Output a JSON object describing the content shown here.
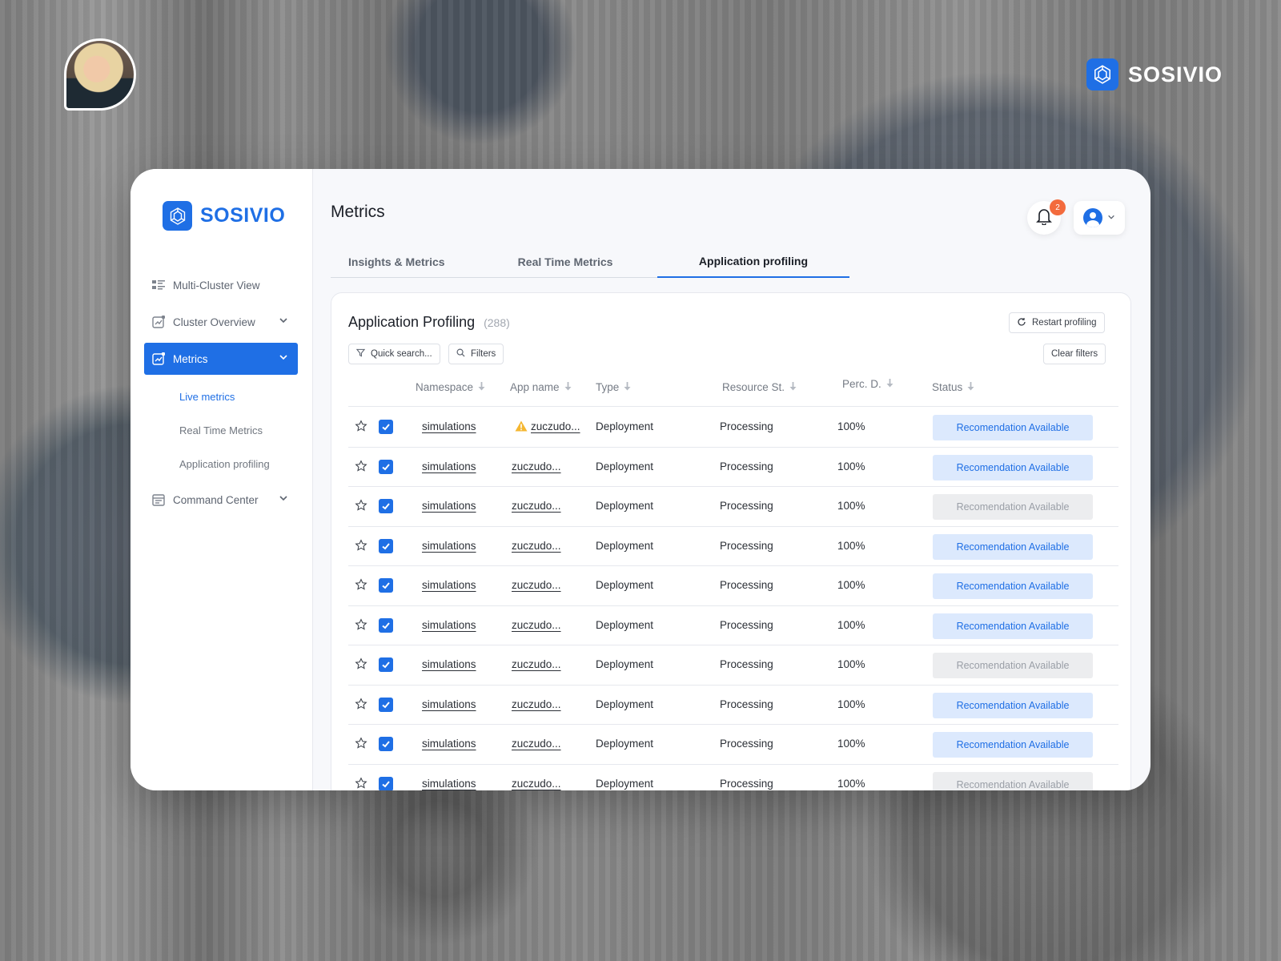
{
  "brand": {
    "name": "SOSIVIO"
  },
  "sidebar": {
    "items": [
      {
        "label": "Multi-Cluster View",
        "icon": "list-icon",
        "expandable": false
      },
      {
        "label": "Cluster Overview",
        "icon": "chart-icon",
        "expandable": true
      },
      {
        "label": "Metrics",
        "icon": "chart-icon",
        "expandable": true,
        "active": true
      },
      {
        "label": "Command Center",
        "icon": "calendar-icon",
        "expandable": true
      }
    ],
    "sub_items": [
      {
        "label": "Live metrics",
        "active": true
      },
      {
        "label": "Real Time Metrics",
        "active": false
      },
      {
        "label": "Application profiling",
        "active": false
      }
    ]
  },
  "header": {
    "title": "Metrics",
    "notifications_count": "2"
  },
  "tabs": [
    {
      "label": "Insights & Metrics",
      "active": false
    },
    {
      "label": "Real Time Metrics",
      "active": false
    },
    {
      "label": "Application profiling",
      "active": true
    }
  ],
  "panel": {
    "title": "Application Profiling",
    "count": "(288)",
    "restart_label": "Restart profiling",
    "quick_search_label": "Quick search...",
    "filters_label": "Filters",
    "clear_filters_label": "Clear filters"
  },
  "table": {
    "columns": [
      "Namespace",
      "App name",
      "Type",
      "Resource St.",
      "Perc. D.",
      "Status"
    ],
    "rows": [
      {
        "namespace": "simulations",
        "app": "zuczudo...",
        "warning": true,
        "type": "Deployment",
        "resource": "Processing",
        "perc": "100%",
        "status": "Recomendation Available",
        "status_enabled": true
      },
      {
        "namespace": "simulations",
        "app": "zuczudo...",
        "warning": false,
        "type": "Deployment",
        "resource": "Processing",
        "perc": "100%",
        "status": "Recomendation Available",
        "status_enabled": true
      },
      {
        "namespace": "simulations",
        "app": "zuczudo...",
        "warning": false,
        "type": "Deployment",
        "resource": "Processing",
        "perc": "100%",
        "status": "Recomendation Available",
        "status_enabled": false
      },
      {
        "namespace": "simulations",
        "app": "zuczudo...",
        "warning": false,
        "type": "Deployment",
        "resource": "Processing",
        "perc": "100%",
        "status": "Recomendation Available",
        "status_enabled": true
      },
      {
        "namespace": "simulations",
        "app": "zuczudo...",
        "warning": false,
        "type": "Deployment",
        "resource": "Processing",
        "perc": "100%",
        "status": "Recomendation Available",
        "status_enabled": true
      },
      {
        "namespace": "simulations",
        "app": "zuczudo...",
        "warning": false,
        "type": "Deployment",
        "resource": "Processing",
        "perc": "100%",
        "status": "Recomendation Available",
        "status_enabled": true
      },
      {
        "namespace": "simulations",
        "app": "zuczudo...",
        "warning": false,
        "type": "Deployment",
        "resource": "Processing",
        "perc": "100%",
        "status": "Recomendation Available",
        "status_enabled": false
      },
      {
        "namespace": "simulations",
        "app": "zuczudo...",
        "warning": false,
        "type": "Deployment",
        "resource": "Processing",
        "perc": "100%",
        "status": "Recomendation Available",
        "status_enabled": true
      },
      {
        "namespace": "simulations",
        "app": "zuczudo...",
        "warning": false,
        "type": "Deployment",
        "resource": "Processing",
        "perc": "100%",
        "status": "Recomendation Available",
        "status_enabled": true
      },
      {
        "namespace": "simulations",
        "app": "zuczudo...",
        "warning": false,
        "type": "Deployment",
        "resource": "Processing",
        "perc": "100%",
        "status": "Recomendation Available",
        "status_enabled": false
      }
    ]
  },
  "colors": {
    "accent": "#1f6fe5",
    "badge": "#f36b3d",
    "status_enabled_bg": "#dce9fd",
    "status_disabled_bg": "#ecedef",
    "warning": "#f5b731"
  }
}
